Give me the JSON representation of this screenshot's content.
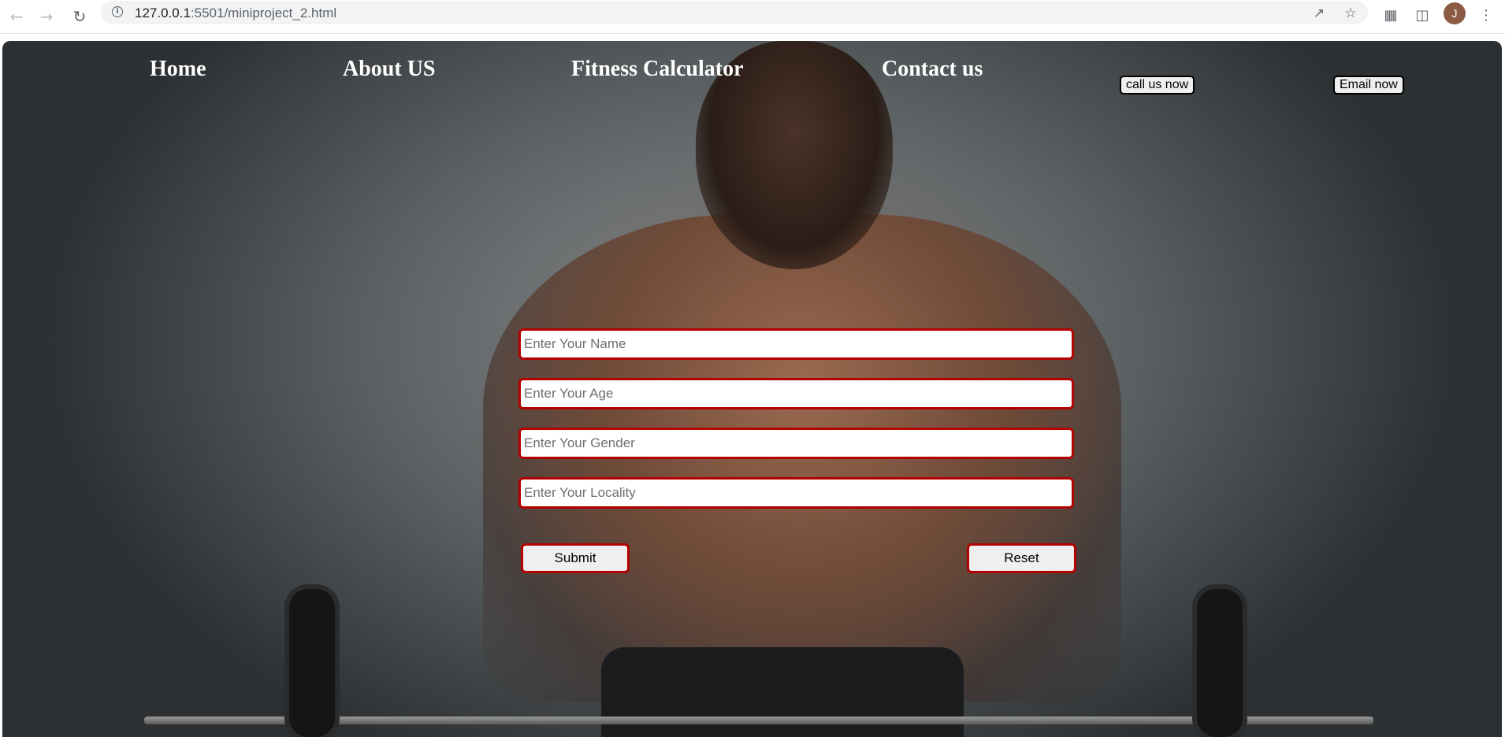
{
  "browser": {
    "url_host": "127.0.0.1",
    "url_rest": ":5501/miniproject_2.html",
    "profile_initial": "J",
    "icons": {
      "back": "back-arrow-icon",
      "forward": "forward-arrow-icon",
      "reload": "reload-icon",
      "info": "info-icon",
      "share": "share-icon",
      "bookmark": "star-icon",
      "extensions": "puzzle-icon",
      "sidepanel": "side-panel-icon",
      "menu": "kebab-menu-icon"
    }
  },
  "nav": {
    "links": [
      "Home",
      "About US",
      "Fitness Calculator",
      "Contact us"
    ],
    "call_button": "call us now",
    "email_button": "Email now"
  },
  "form": {
    "name_placeholder": "Enter Your Name",
    "age_placeholder": "Enter Your Age",
    "gender_placeholder": "Enter Your Gender",
    "locality_placeholder": "Enter Your Locality",
    "submit_label": "Submit",
    "reset_label": "Reset"
  },
  "colors": {
    "field_border": "#b30000",
    "nav_text": "#ffffff"
  }
}
